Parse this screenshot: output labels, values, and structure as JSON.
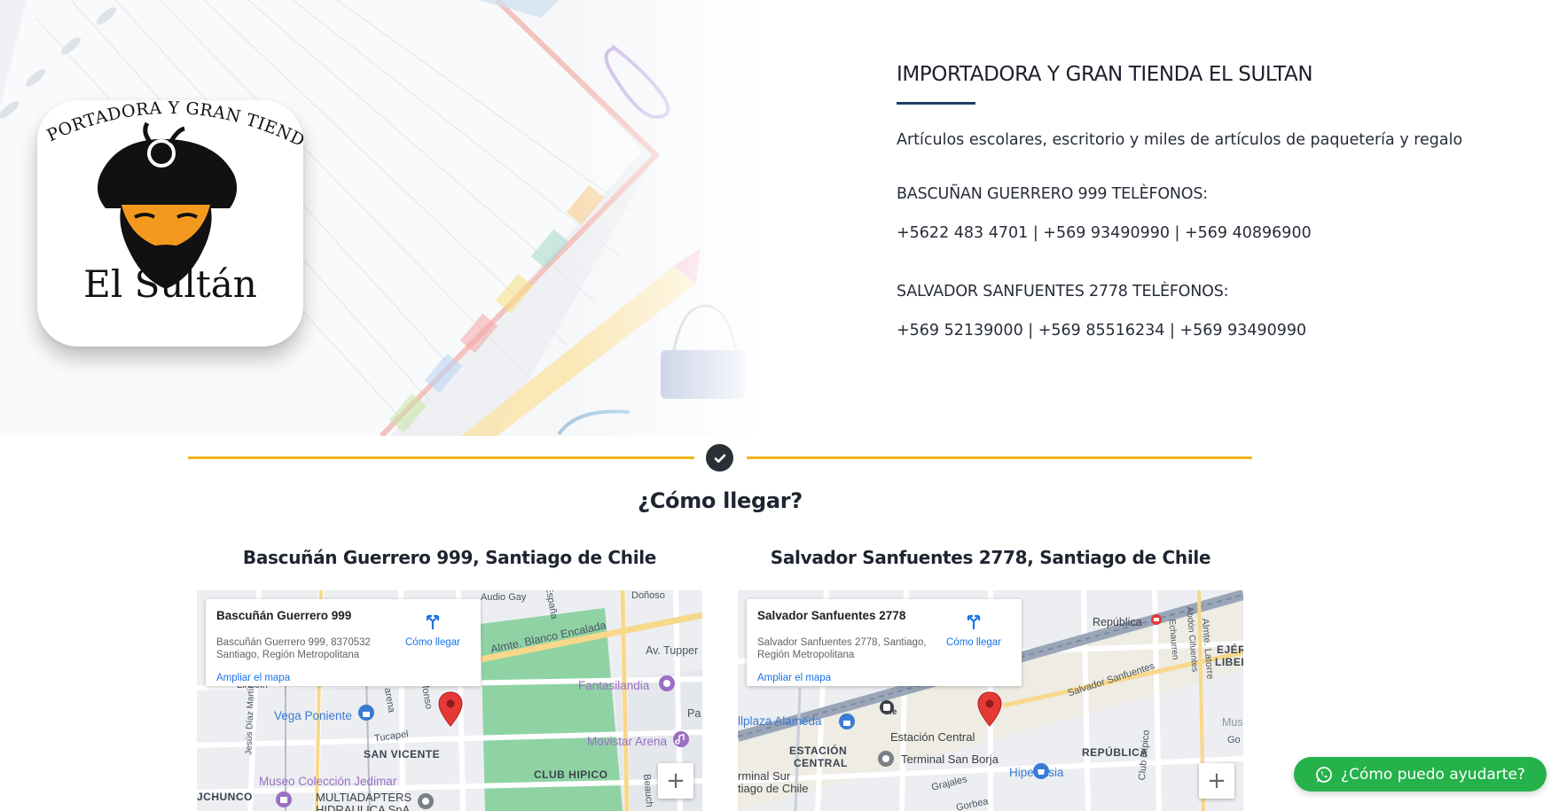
{
  "store": {
    "title": "IMPORTADORA Y GRAN TIENDA EL SULTAN",
    "tagline": "Artículos escolares, escritorio y miles de artículos de paquetería y regalo",
    "branch1_heading": "BASCUÑAN GUERRERO 999 TELÈFONOS:",
    "branch1_phones": "+5622 483 4701 | +569 93490990 | +569 40896900",
    "branch2_heading": "SALVADOR SANFUENTES 2778 TELÈFONOS:",
    "branch2_phones": "+569 52139000 | +569 85516234 | +569 93490990"
  },
  "logo": {
    "arc_text": "IMPORTADORA Y GRAN TIENDA",
    "name": "El Sultán"
  },
  "directions": {
    "title": "¿Cómo llegar?"
  },
  "maps": [
    {
      "heading": "Bascuñán Guerrero 999, Santiago de Chile",
      "card": {
        "place": "Bascuñán Guerrero 999",
        "address": "Bascuñán Guerrero 999, 8370532 Santiago, Región Metropolitana",
        "directions_label": "Cómo llegar",
        "enlarge_label": "Ampliar el mapa"
      },
      "labels": {
        "gay": "Audio Gay",
        "espana": "España",
        "donoso": "Doñoso",
        "almte": "Almte. Blanco Encalada",
        "tupper": "Av. Tupper",
        "fantasilandia": "Fantasilandia",
        "pa": "Pa",
        "vega": "Vega Poniente",
        "tucapel": "Tucapel",
        "movistar": "Movistar Arena",
        "sanvicente": "SAN VICENTE",
        "clubhipico": "CLUB HIPICO",
        "museo": "Museo Colección Jedimar",
        "multiadapters": "MULTIADAPTERS",
        "hidraulica": "HIDRAULICA SpA",
        "chunco": "JCHUNCO",
        "lincoln": "Lincoln",
        "jesus": "Jesús Díaz Martín",
        "beauchef": "Beauch",
        "alfonso": "Alfonso",
        "arena": "arena"
      },
      "zoom_in": "+"
    },
    {
      "heading": "Salvador Sanfuentes 2778, Santiago de Chile",
      "card": {
        "place": "Salvador Sanfuentes 2778",
        "address": "Salvador Sanfuentes 2778, Santiago, Región Metropolitana",
        "directions_label": "Cómo llegar",
        "enlarge_label": "Ampliar el mapa"
      },
      "labels": {
        "republica": "República",
        "ejer": "EJÉR",
        "liber": "LIBER",
        "salvador": "Salvador Sanfuentes",
        "plaza": "llplaza Alameda",
        "estacion": "Estación Central",
        "estacion_area1": "ESTACIÓN",
        "estacion_area2": "CENTRAL",
        "terminal": "Terminal San Borja",
        "republica_area": "REPÚBLICA",
        "hiper": "Hiper Asia",
        "terminal_sur": "rminal Sur",
        "santiago": "tiago de Chile",
        "grajales": "Grajales",
        "gorbea": "Gorbea",
        "echaurren": "Echaurren",
        "abdon": "Abdón Cifuentes",
        "latorre": "Almte. Latorre",
        "hipico": "Club Hípico",
        "mus": "Mus",
        "go": "Go",
        "efe": "efe"
      },
      "zoom_in": "+"
    }
  ],
  "whatsapp": {
    "label": "¿Cómo puedo ayudarte?"
  },
  "colors": {
    "accent_gold": "#f1b51d",
    "title_underline": "#1e3f66",
    "whatsapp_green": "#25b24a",
    "map_park": "#8fd3a4",
    "pin_red": "#e53935"
  }
}
